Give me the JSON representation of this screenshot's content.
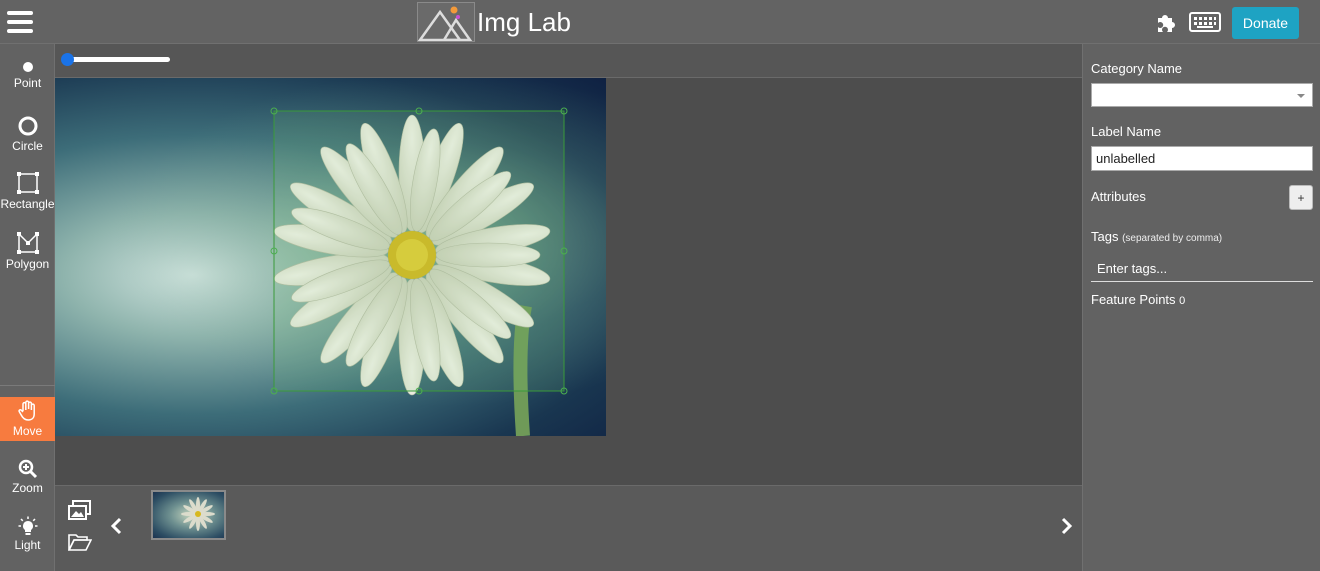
{
  "header": {
    "app_title": "Img Lab",
    "donate_label": "Donate",
    "icons": [
      "menu-icon",
      "puzzle-icon",
      "keyboard-icon"
    ]
  },
  "toolbar": {
    "tools": [
      {
        "label": "Point",
        "icon": "point-icon"
      },
      {
        "label": "Circle",
        "icon": "circle-icon"
      },
      {
        "label": "Rectangle",
        "icon": "rectangle-icon"
      },
      {
        "label": "Polygon",
        "icon": "polygon-icon"
      },
      {
        "label": "Move",
        "icon": "hand-icon",
        "active": true
      },
      {
        "label": "Zoom",
        "icon": "zoom-icon"
      },
      {
        "label": "Light",
        "icon": "light-icon"
      }
    ],
    "active_color": "#f77b3f"
  },
  "canvas": {
    "zoom_slider_value": 0,
    "selection_color": "#3a9a3a"
  },
  "filmstrip": {
    "icons": [
      "images-icon",
      "folder-open-icon",
      "chevron-left-icon",
      "chevron-right-icon"
    ]
  },
  "panel": {
    "category_name_label": "Category Name",
    "category_value": "",
    "label_name_label": "Label Name",
    "label_name_value": "unlabelled",
    "attributes_label": "Attributes",
    "add_attribute_label": "+",
    "tags_label": "Tags",
    "tags_hint": "(separated by comma)",
    "tags_placeholder": "Enter tags...",
    "feature_points_label": "Feature Points",
    "feature_points_count": "0"
  },
  "colors": {
    "donate": "#1ea3c3",
    "slider_thumb": "#1a73e8"
  }
}
